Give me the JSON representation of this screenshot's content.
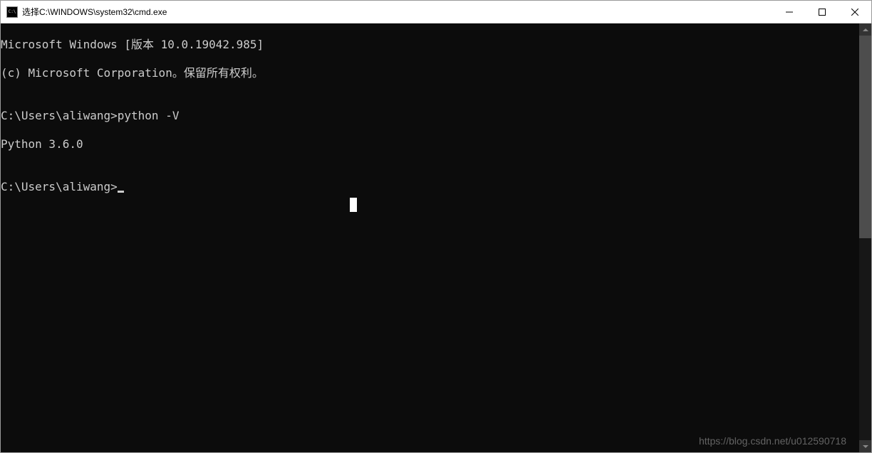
{
  "titlebar": {
    "title": "选择C:\\WINDOWS\\system32\\cmd.exe"
  },
  "terminal": {
    "line1": "Microsoft Windows [版本 10.0.19042.985]",
    "line2": "(c) Microsoft Corporation。保留所有权利。",
    "blank1": "",
    "prompt1": "C:\\Users\\aliwang>python -V",
    "output1": "Python 3.6.0",
    "blank2": "",
    "prompt2": "C:\\Users\\aliwang>"
  },
  "watermark": "https://blog.csdn.net/u012590718"
}
